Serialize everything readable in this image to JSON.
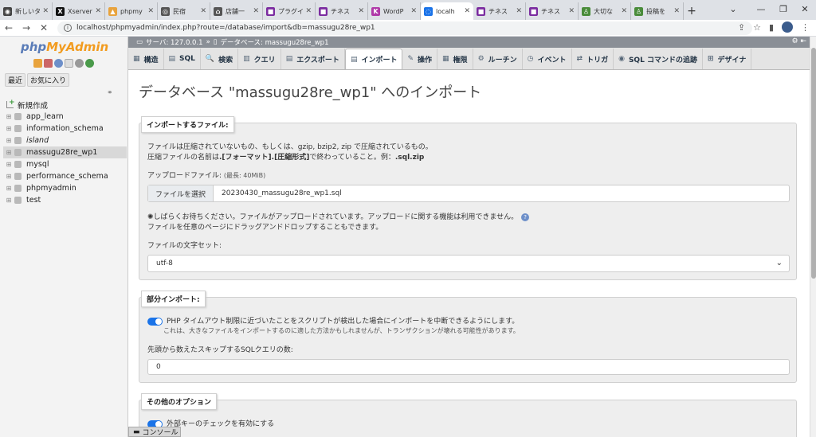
{
  "browser": {
    "tabs": [
      {
        "label": "新しいタ",
        "color": "#444444",
        "glyph": "◉"
      },
      {
        "label": "Xserver",
        "color": "#111111",
        "glyph": "X"
      },
      {
        "label": "phpmy",
        "color": "#e8a33d",
        "glyph": "▲"
      },
      {
        "label": "民宿",
        "color": "#555555",
        "glyph": "◎"
      },
      {
        "label": "店舗一",
        "color": "#555555",
        "glyph": "⌂"
      },
      {
        "label": "プラグイ",
        "color": "#7b2ca0",
        "glyph": "■"
      },
      {
        "label": "チネス",
        "color": "#7b2ca0",
        "glyph": "■"
      },
      {
        "label": "WordP",
        "color": "#b03aa8",
        "glyph": "K"
      },
      {
        "label": "localh",
        "color": "#1a73e8",
        "glyph": "◌",
        "active": true
      },
      {
        "label": "チネス",
        "color": "#7b2ca0",
        "glyph": "■"
      },
      {
        "label": "チネス",
        "color": "#7b2ca0",
        "glyph": "■"
      },
      {
        "label": "大切な",
        "color": "#4a8c3a",
        "glyph": "♙"
      },
      {
        "label": "投稿を",
        "color": "#4a8c3a",
        "glyph": "♙"
      }
    ],
    "new_tab": "+",
    "url": "localhost/phpmyadmin/index.php?route=/database/import&db=massugu28re_wp1"
  },
  "sidebar": {
    "logo_php": "php",
    "logo_myadmin": "MyAdmin",
    "recent_label": "最近",
    "favorites_label": "お気に入り",
    "new_label": "新規作成",
    "databases": [
      {
        "name": "app_learn"
      },
      {
        "name": "information_schema"
      },
      {
        "name": "island",
        "italic": true
      },
      {
        "name": "massugu28re_wp1",
        "selected": true
      },
      {
        "name": "mysql"
      },
      {
        "name": "performance_schema"
      },
      {
        "name": "phpmyadmin"
      },
      {
        "name": "test"
      }
    ]
  },
  "breadcrumb": {
    "server": "サーバ: 127.0.0.1",
    "sep": "»",
    "database": "データベース: massugu28re_wp1"
  },
  "menu": [
    {
      "icon": "structure-icon",
      "glyph": "▦",
      "label": "構造"
    },
    {
      "icon": "sql-icon",
      "glyph": "▤",
      "label": "SQL"
    },
    {
      "icon": "search-icon",
      "glyph": "🔍",
      "label": "検索"
    },
    {
      "icon": "query-icon",
      "glyph": "▥",
      "label": "クエリ"
    },
    {
      "icon": "export-icon",
      "glyph": "▤",
      "label": "エクスポート"
    },
    {
      "icon": "import-icon",
      "glyph": "▤",
      "label": "インポート",
      "active": true
    },
    {
      "icon": "operations-icon",
      "glyph": "✎",
      "label": "操作"
    },
    {
      "icon": "privileges-icon",
      "glyph": "▦",
      "label": "権限"
    },
    {
      "icon": "routines-icon",
      "glyph": "⚙",
      "label": "ルーチン"
    },
    {
      "icon": "events-icon",
      "glyph": "◷",
      "label": "イベント"
    },
    {
      "icon": "triggers-icon",
      "glyph": "⇄",
      "label": "トリガ"
    },
    {
      "icon": "tracking-icon",
      "glyph": "◉",
      "label": "SQL コマンドの追跡"
    },
    {
      "icon": "designer-icon",
      "glyph": "⊞",
      "label": "デザイナ"
    }
  ],
  "page": {
    "title": "データベース \"massugu28re_wp1\" へのインポート"
  },
  "file_section": {
    "legend": "インポートするファイル:",
    "desc1": "ファイルは圧縮されていないもの、もしくは、gzip, bzip2, zip で圧縮されているもの。",
    "desc2_pre": "圧縮ファイルの名前は",
    "desc2_bold": ".[フォーマット].[圧縮形式]",
    "desc2_mid": "で終わっていること。例：",
    "desc2_ex": ".sql.zip",
    "upload_label": "アップロードファイル:",
    "upload_max": "(最長: 40MiB)",
    "choose_button": "ファイルを選択",
    "file_name": "20230430_massugu28re_wp1.sql",
    "wait_msg": "しばらくお待ちください。ファイルがアップロードされています。アップロードに関する機能は利用できません。",
    "drag_msg": "ファイルを任意のページにドラッグアンドドロップすることもできます。",
    "charset_label": "ファイルの文字セット:",
    "charset_value": "utf-8"
  },
  "partial_section": {
    "legend": "部分インポート:",
    "timeout_label": "PHP タイムアウト制限に近づいたことをスクリプトが検出した場合にインポートを中断できるようにします。",
    "timeout_note": "これは、大きなファイルをインポートするのに適した方法かもしれませんが、トランザクションが壊れる可能性があります。",
    "skip_label": "先頭から数えたスキップするSQLクエリの数:",
    "skip_value": "0"
  },
  "other_section": {
    "legend": "その他のオプション",
    "fk_label": "外部キーのチェックを有効にする"
  },
  "console": {
    "label": "コンソール"
  }
}
